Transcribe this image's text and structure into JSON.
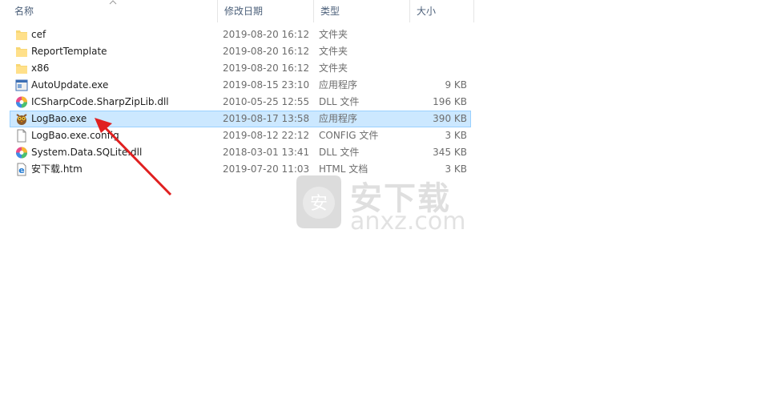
{
  "columns": {
    "name": "名称",
    "date": "修改日期",
    "type": "类型",
    "size": "大小"
  },
  "files": [
    {
      "name": "cef",
      "date": "2019-08-20 16:12",
      "type": "文件夹",
      "size": "",
      "icon": "folder-icon"
    },
    {
      "name": "ReportTemplate",
      "date": "2019-08-20 16:12",
      "type": "文件夹",
      "size": "",
      "icon": "folder-icon"
    },
    {
      "name": "x86",
      "date": "2019-08-20 16:12",
      "type": "文件夹",
      "size": "",
      "icon": "folder-icon"
    },
    {
      "name": "AutoUpdate.exe",
      "date": "2019-08-15 23:10",
      "type": "应用程序",
      "size": "9 KB",
      "icon": "exe-app-icon"
    },
    {
      "name": "ICSharpCode.SharpZipLib.dll",
      "date": "2010-05-25 12:55",
      "type": "DLL 文件",
      "size": "196 KB",
      "icon": "dll-icon"
    },
    {
      "name": "LogBao.exe",
      "date": "2019-08-17 13:58",
      "type": "应用程序",
      "size": "390 KB",
      "icon": "logbao-owl-icon",
      "selected": true
    },
    {
      "name": "LogBao.exe.config",
      "date": "2019-08-12 22:12",
      "type": "CONFIG 文件",
      "size": "3 KB",
      "icon": "blank-file-icon"
    },
    {
      "name": "System.Data.SQLite.dll",
      "date": "2018-03-01 13:41",
      "type": "DLL 文件",
      "size": "345 KB",
      "icon": "dll-icon"
    },
    {
      "name": "安下载.htm",
      "date": "2019-07-20 11:03",
      "type": "HTML 文档",
      "size": "3 KB",
      "icon": "edge-html-icon"
    }
  ],
  "watermark": {
    "title": "安下载",
    "url": "anxz.com",
    "badge": "安"
  },
  "annotation": {
    "arrow_color": "#e02020",
    "arrow_target": "LogBao.exe"
  }
}
